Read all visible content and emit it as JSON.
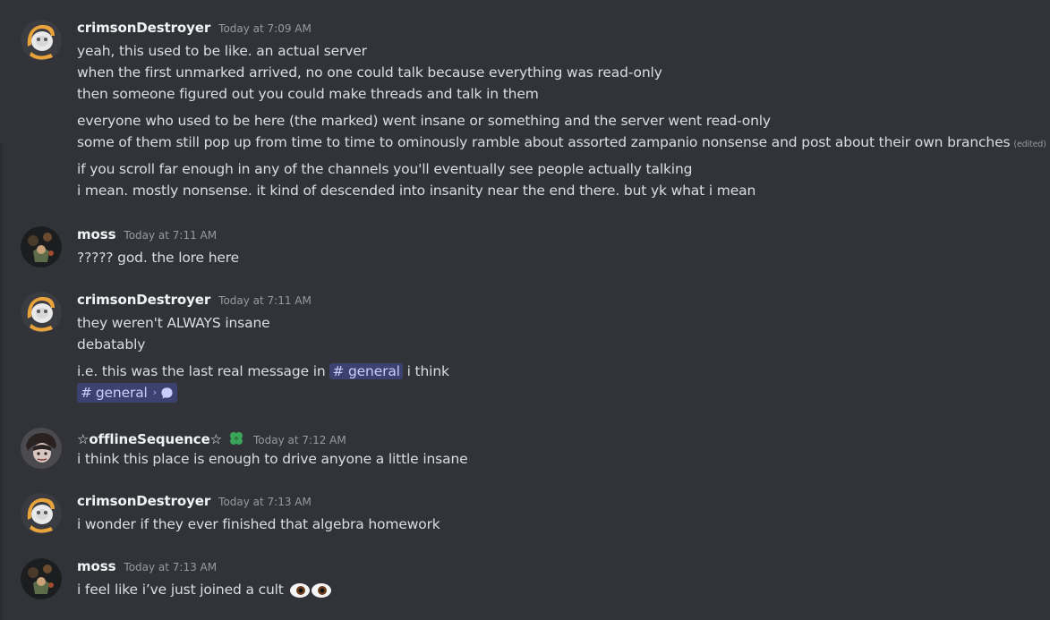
{
  "messages": [
    {
      "username": "crimsonDestroyer",
      "timestamp": "Today at 7:09 AM",
      "lines": [
        "yeah, this used to be like. an actual server",
        "when the first unmarked arrived, no one could talk because everything was read-only",
        "then someone figured out you could make threads and talk in them",
        "everyone who used to be here (the marked) went insane or something and the server went read-only",
        "some of them still pop up from time to time to ominously ramble about assorted zampanio nonsense and post about their own branches",
        "if you scroll far enough in any of the channels you'll eventually see people actually talking",
        "i mean. mostly nonsense. it kind of descended into insanity near the end there. but yk what i mean"
      ],
      "edited_label": "(edited)"
    },
    {
      "username": "moss",
      "timestamp": "Today at 7:11 AM",
      "lines": [
        "????? god. the lore here"
      ]
    },
    {
      "username": "crimsonDestroyer",
      "timestamp": "Today at 7:11 AM",
      "lines": [
        "they weren't ALWAYS insane",
        "debatably",
        "i.e. this was the last real message in",
        "i think"
      ],
      "channel_mention": "# general",
      "channel_link_label": "general",
      "channel_link_hash": "#"
    },
    {
      "username": "☆offlineSequence☆",
      "timestamp": "Today at 7:12 AM",
      "lines": [
        "i think this place is enough to drive anyone a little insane"
      ]
    },
    {
      "username": "crimsonDestroyer",
      "timestamp": "Today at 7:13 AM",
      "lines": [
        "i wonder if they ever finished that algebra homework"
      ]
    },
    {
      "username": "moss",
      "timestamp": "Today at 7:13 AM",
      "lines": [
        "i feel like i’ve just joined a cult"
      ]
    }
  ],
  "colors": {
    "background": "#313338",
    "text": "#dbdee1",
    "username": "#f2f3f5",
    "timestamp": "#949ba4",
    "mention_bg": "#3c4270",
    "mention_text": "#c9cdfb",
    "badge_green": "#3ba55c"
  },
  "icons": [
    "avatar-crimson",
    "avatar-moss",
    "avatar-offline",
    "clover-badge-icon",
    "chevron-right-icon",
    "speech-bubble-icon",
    "eyes-emoji"
  ]
}
